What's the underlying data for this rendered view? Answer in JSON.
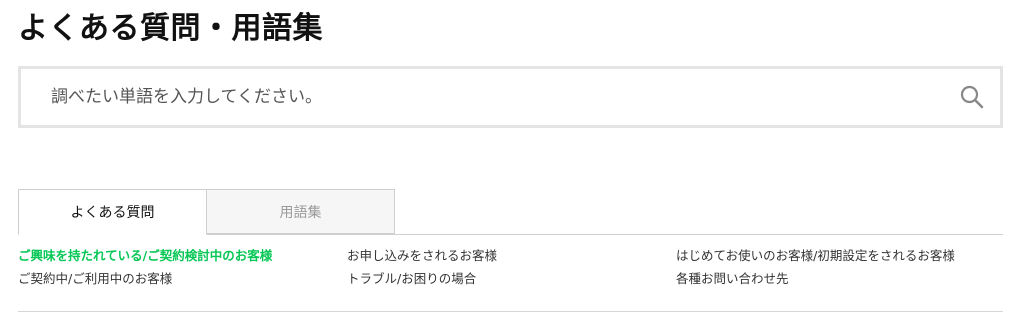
{
  "page": {
    "title": "よくある質問・用語集"
  },
  "search": {
    "placeholder": "調べたい単語を入力してください。",
    "value": "",
    "icon": "search-icon"
  },
  "tabs": [
    {
      "label": "よくある質問",
      "active": true
    },
    {
      "label": "用語集",
      "active": false
    }
  ],
  "categories": {
    "col1": [
      {
        "label": "ご興味を持たれている/ご契約検討中のお客様",
        "active": true
      },
      {
        "label": "ご契約中/ご利用中のお客様",
        "active": false
      }
    ],
    "col2": [
      {
        "label": "お申し込みをされるお客様",
        "active": false
      },
      {
        "label": "トラブル/お困りの場合",
        "active": false
      }
    ],
    "col3": [
      {
        "label": "はじめてお使いのお客様/初期設定をされるお客様",
        "active": false
      },
      {
        "label": "各種お問い合わせ先",
        "active": false
      }
    ]
  },
  "colors": {
    "accent": "#06c755",
    "text": "#333333",
    "border": "#e4e4e4"
  }
}
